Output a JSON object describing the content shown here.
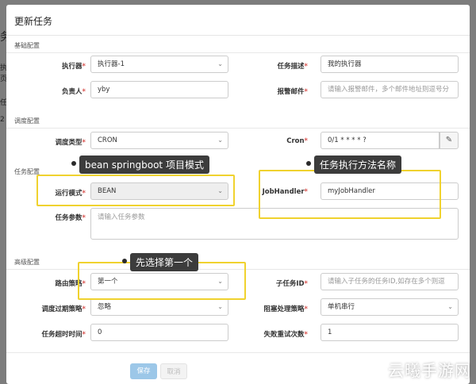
{
  "backdrop": {
    "fragments": [
      "务",
      "执",
      "页",
      "任",
      "2"
    ]
  },
  "modal": {
    "title": "更新任务"
  },
  "sections": {
    "basic": "基础配置",
    "schedule": "调度配置",
    "task": "任务配置",
    "advanced": "高级配置"
  },
  "fields": {
    "executor": {
      "label": "执行器",
      "value": "执行器-1"
    },
    "description": {
      "label": "任务描述",
      "value": "我的执行器"
    },
    "owner": {
      "label": "负责人",
      "value": "yby"
    },
    "alarm_email": {
      "label": "报警邮件",
      "placeholder": "请输入报警邮件，多个邮件地址则逗号分"
    },
    "schedule_type": {
      "label": "调度类型",
      "value": "CRON"
    },
    "cron": {
      "label": "Cron",
      "value": "0/1 * * * * ?"
    },
    "run_mode": {
      "label": "运行模式",
      "value": "BEAN"
    },
    "job_handler": {
      "label": "JobHandler",
      "value": "myJobHandler"
    },
    "task_param": {
      "label": "任务参数",
      "placeholder": "请输入任务参数"
    },
    "route_strategy": {
      "label": "路由策略",
      "value": "第一个"
    },
    "child_job_id": {
      "label": "子任务ID",
      "placeholder": "请输入子任务的任务ID,如存在多个则逗"
    },
    "misfire_strategy": {
      "label": "调度过期策略",
      "value": "忽略"
    },
    "block_strategy": {
      "label": "阻塞处理策略",
      "value": "单机串行"
    },
    "timeout": {
      "label": "任务超时时间",
      "value": "0"
    },
    "retry_count": {
      "label": "失败重试次数",
      "value": "1"
    }
  },
  "required_mark": "*",
  "buttons": {
    "save": "保存",
    "cancel": "取消"
  },
  "callouts": {
    "bean": "bean springboot 项目模式",
    "handler": "任务执行方法名称",
    "route": "先选择第一个"
  },
  "icons": {
    "caret": "chevron-down-icon",
    "edit": "edit-icon"
  },
  "colors": {
    "highlight": "#f0d22e",
    "save_button": "#9cc7e8",
    "required": "#d9534f"
  },
  "watermark": "云曦手游网"
}
